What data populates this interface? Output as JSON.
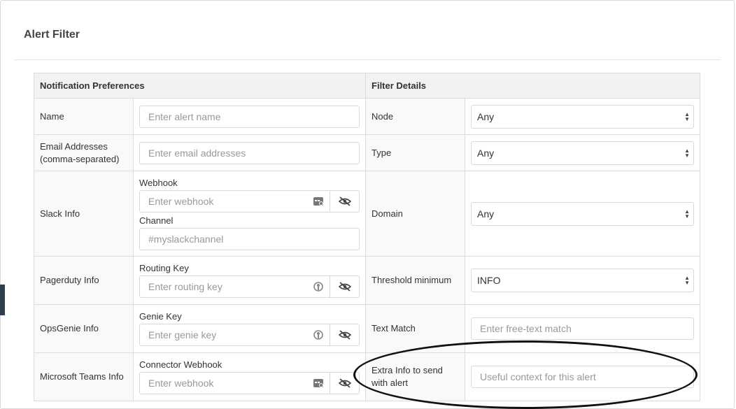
{
  "modal": {
    "title": "Alert Filter"
  },
  "table": {
    "headers": {
      "left": "Notification Preferences",
      "right": "Filter Details"
    },
    "name": {
      "label": "Name",
      "placeholder": "Enter alert name"
    },
    "email": {
      "label": "Email Addresses (comma-separated)",
      "placeholder": "Enter email addresses"
    },
    "slack": {
      "label": "Slack Info",
      "webhook_label": "Webhook",
      "webhook_placeholder": "Enter webhook",
      "channel_label": "Channel",
      "channel_placeholder": "#myslackchannel"
    },
    "pagerduty": {
      "label": "Pagerduty Info",
      "key_label": "Routing Key",
      "key_placeholder": "Enter routing key"
    },
    "opsgenie": {
      "label": "OpsGenie Info",
      "key_label": "Genie Key",
      "key_placeholder": "Enter genie key"
    },
    "teams": {
      "label": "Microsoft Teams Info",
      "key_label": "Connector Webhook",
      "key_placeholder": "Enter webhook"
    },
    "node": {
      "label": "Node",
      "value": "Any"
    },
    "type": {
      "label": "Type",
      "value": "Any"
    },
    "domain": {
      "label": "Domain",
      "value": "Any"
    },
    "threshold": {
      "label": "Threshold minimum",
      "value": "INFO"
    },
    "text_match": {
      "label": "Text Match",
      "placeholder": "Enter free-text match"
    },
    "extra_info": {
      "label": "Extra Info to send with alert",
      "placeholder": "Useful context for this alert"
    }
  },
  "icons": {
    "eye_slash": "eye-slash-icon",
    "webhook": "webhook-icon",
    "key": "key-icon"
  }
}
